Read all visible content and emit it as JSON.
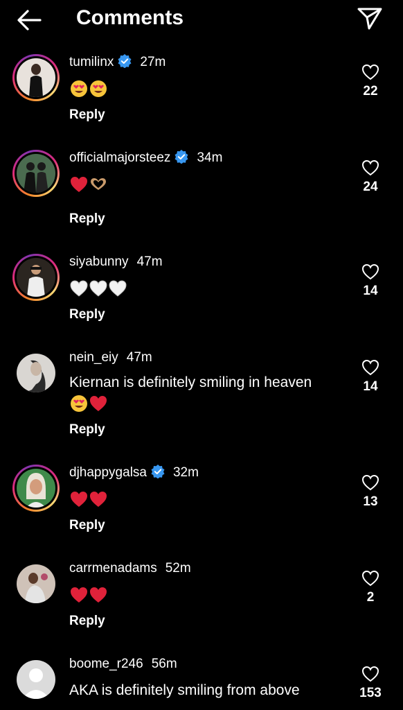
{
  "header": {
    "title": "Comments"
  },
  "reply_label": "Reply",
  "comments": [
    {
      "username": "tumilinx",
      "verified": true,
      "time": "27m",
      "likes": "22",
      "emojis": [
        "heart-eyes-face",
        "heart-eyes-face"
      ]
    },
    {
      "username": "officialmajorsteez",
      "verified": true,
      "time": "34m",
      "likes": "24",
      "emojis": [
        "red-heart",
        "heart-hands"
      ]
    },
    {
      "username": "siyabunny",
      "verified": false,
      "time": "47m",
      "likes": "14",
      "emojis": [
        "white-heart",
        "white-heart",
        "white-heart"
      ]
    },
    {
      "username": "nein_eiy",
      "verified": false,
      "time": "47m",
      "likes": "14",
      "text": "Kiernan is definitely smiling in heaven",
      "emojis": [
        "heart-eyes-face",
        "red-heart"
      ]
    },
    {
      "username": "djhappygalsa",
      "verified": true,
      "time": "32m",
      "likes": "13",
      "emojis": [
        "red-heart",
        "red-heart"
      ]
    },
    {
      "username": "carrmenadams",
      "verified": false,
      "time": "52m",
      "likes": "2",
      "emojis": [
        "red-heart",
        "red-heart"
      ]
    },
    {
      "username": "boome_r246",
      "verified": false,
      "time": "56m",
      "likes": "153",
      "text": "AKA is definitely smiling from above"
    }
  ],
  "colors": {
    "background": "#000000",
    "verified": "#3897f0",
    "text": "#ffffff"
  }
}
